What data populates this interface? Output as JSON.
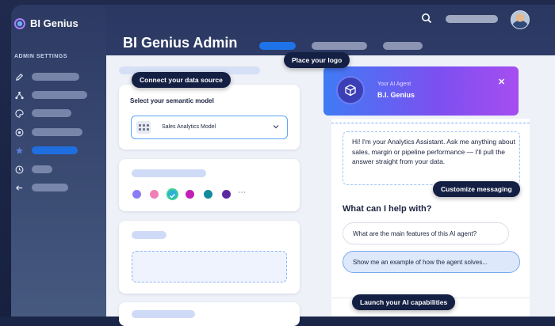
{
  "app": {
    "name": "BI Genius"
  },
  "sidebar": {
    "section_label": "ADMIN SETTINGS",
    "items": [
      {
        "icon": "pencil-icon"
      },
      {
        "icon": "network-icon"
      },
      {
        "icon": "palette-icon"
      },
      {
        "icon": "target-icon"
      },
      {
        "icon": "star-icon",
        "active": true
      },
      {
        "icon": "clock-icon"
      },
      {
        "icon": "back-arrow-icon"
      }
    ]
  },
  "header": {
    "title": "BI Genius Admin"
  },
  "semantic_model": {
    "label": "Select your semantic model",
    "selected": "Sales Analytics Model"
  },
  "brand_colors": [
    "#8b7cf6",
    "#f07fb6",
    "#2bb3d6",
    "#c21fb6",
    "#138a9e",
    "#5b2a9e"
  ],
  "agent": {
    "subtitle": "Your AI Agent",
    "name": "B.I. Genius",
    "greeting": "Hi! I'm your Analytics Assistant. Ask me anything about sales, margin or pipeline performance — I'll pull the answer straight from your data.",
    "help_title": "What can I help with?",
    "suggestions": [
      "What are the main features of this AI agent?",
      "Show me an example of how the agent solves..."
    ]
  },
  "callouts": {
    "connect": "Connect your data source",
    "logo": "Place your logo",
    "messaging": "Customize messaging",
    "launch": "Launch your AI capabilities"
  },
  "colors": {
    "accent": "#1f6fe0",
    "gradient_start": "#3f7bf4",
    "gradient_end": "#a64ef0"
  }
}
